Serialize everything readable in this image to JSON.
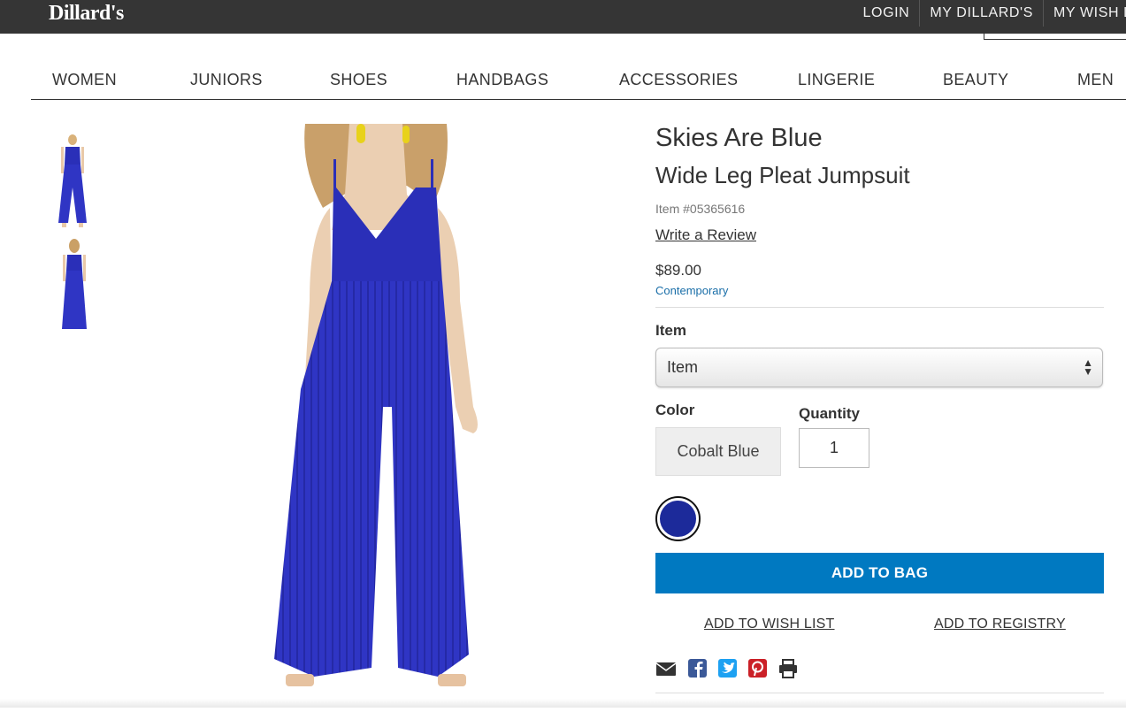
{
  "header": {
    "logo": "Dillard's",
    "links": [
      "LOGIN",
      "MY DILLARD'S",
      "MY WISH LI"
    ]
  },
  "nav": {
    "items": [
      "WOMEN",
      "JUNIORS",
      "SHOES",
      "HANDBAGS",
      "ACCESSORIES",
      "LINGERIE",
      "BEAUTY",
      "MEN"
    ]
  },
  "product": {
    "brand": "Skies Are Blue",
    "name": "Wide Leg Pleat Jumpsuit",
    "item_number": "Item #05365616",
    "review_link": "Write a Review",
    "price": "$89.00",
    "category": "Contemporary"
  },
  "options": {
    "item_label": "Item",
    "item_selected": "Item",
    "color_label": "Color",
    "color_value": "Cobalt Blue",
    "quantity_label": "Quantity",
    "quantity_value": "1",
    "swatch_color": "#1c2a9a"
  },
  "actions": {
    "add_to_bag": "ADD TO BAG",
    "add_to_wish_list": "ADD TO WISH LIST",
    "add_to_registry": "ADD TO REGISTRY"
  },
  "share_icons": [
    "email-icon",
    "facebook-icon",
    "twitter-icon",
    "pinterest-icon",
    "print-icon"
  ],
  "colors": {
    "topbar": "#353535",
    "accent": "#0079c1",
    "dress": "#2a2fb8"
  }
}
